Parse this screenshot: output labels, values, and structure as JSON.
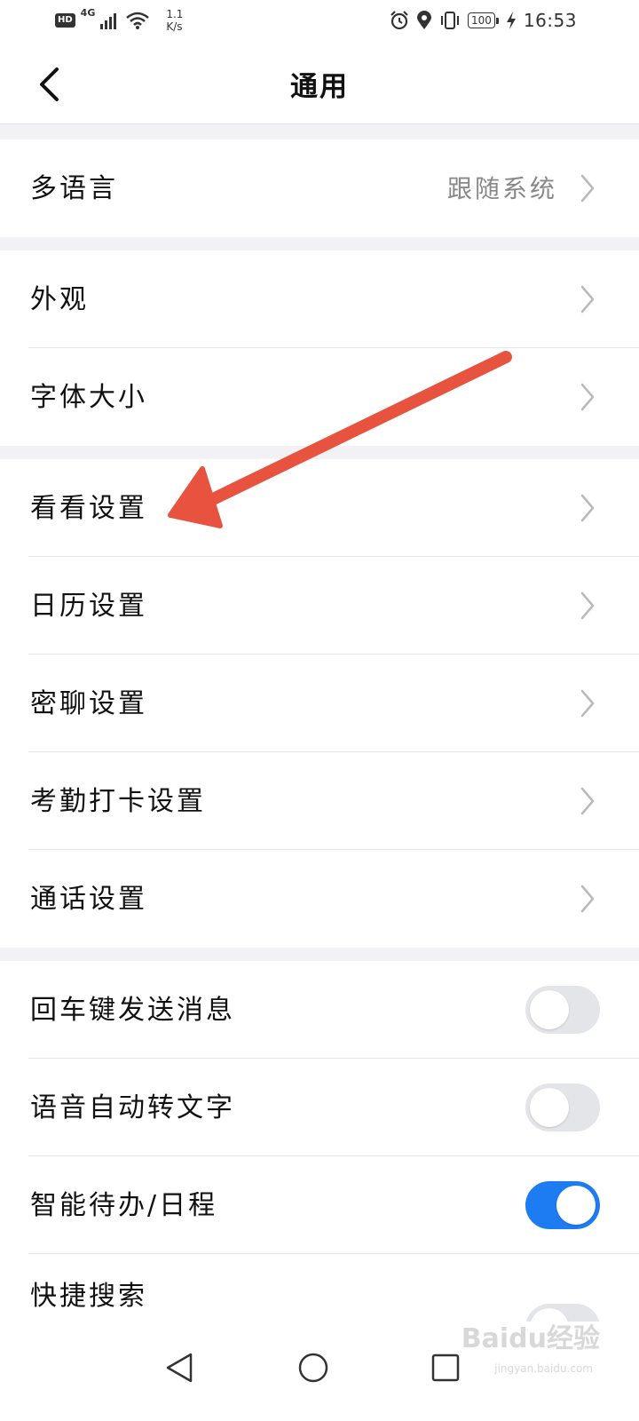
{
  "status_bar": {
    "hd": "HD",
    "network": "4G",
    "speed_value": "1.1",
    "speed_unit": "K/s",
    "battery": "100",
    "time": "16:53"
  },
  "header": {
    "title": "通用"
  },
  "settings": {
    "language": {
      "label": "多语言",
      "value": "跟随系统"
    },
    "appearance": {
      "label": "外观"
    },
    "font_size": {
      "label": "字体大小"
    },
    "kankan": {
      "label": "看看设置"
    },
    "calendar": {
      "label": "日历设置"
    },
    "secret_chat": {
      "label": "密聊设置"
    },
    "attendance": {
      "label": "考勤打卡设置"
    },
    "call": {
      "label": "通话设置"
    },
    "enter_send": {
      "label": "回车键发送消息",
      "enabled": false
    },
    "voice_to_text": {
      "label": "语音自动转文字",
      "enabled": false
    },
    "smart_todo": {
      "label": "智能待办/日程",
      "enabled": true
    },
    "quick_search": {
      "label": "快捷搜索",
      "enabled": false
    }
  },
  "watermark": {
    "text": "Baidu经验",
    "sub": "jingyan.baidu.com"
  },
  "colors": {
    "accent": "#1d7cf2",
    "annotation_arrow": "#e8533f",
    "page_bg": "#f2f2f5"
  }
}
